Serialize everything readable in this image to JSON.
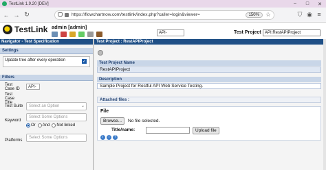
{
  "browser": {
    "title": "TestLink 1.9.20 [DEV]",
    "url": "https://flowchartnow.com/testlink/index.php?caller=login&viewer=",
    "zoom": "150%"
  },
  "app": {
    "logo_text": "TestLink",
    "user": "admin [admin]",
    "tc_search_value": "API-",
    "test_project_label": "Test Project",
    "test_project_value": "API:RestAPIProject"
  },
  "left": {
    "navigator_title": "Navigator - Test Specification",
    "settings_label": "Settings",
    "update_tree_label": "Update tree after every operation",
    "filters_label": "Filters",
    "tc_id_label": "Test Case ID",
    "tc_id_value": "API-",
    "tc_title_label": "Test Case Title",
    "suite_label": "Test Suite",
    "suite_placeholder": "Select an Option",
    "keyword_label": "Keyword",
    "keyword_placeholder": "Select Some Options",
    "or_label": "Or",
    "and_label": "And",
    "not_linked_label": "Not linked",
    "platforms_label": "Platforms",
    "platforms_placeholder": "Select Some Options"
  },
  "right": {
    "header": "Test Project : RestAPIProject",
    "name_label": "Test Project Name",
    "name_value": "RestAPIProject",
    "desc_label": "Description",
    "desc_value": "Sample Project for Restful API Web Service Testing.",
    "attached_label": "Attached files :",
    "file_label": "File",
    "browse_label": "Browse...",
    "no_file_label": "No file selected.",
    "title_name_label": "Title/name:",
    "upload_label": "Upload file"
  }
}
